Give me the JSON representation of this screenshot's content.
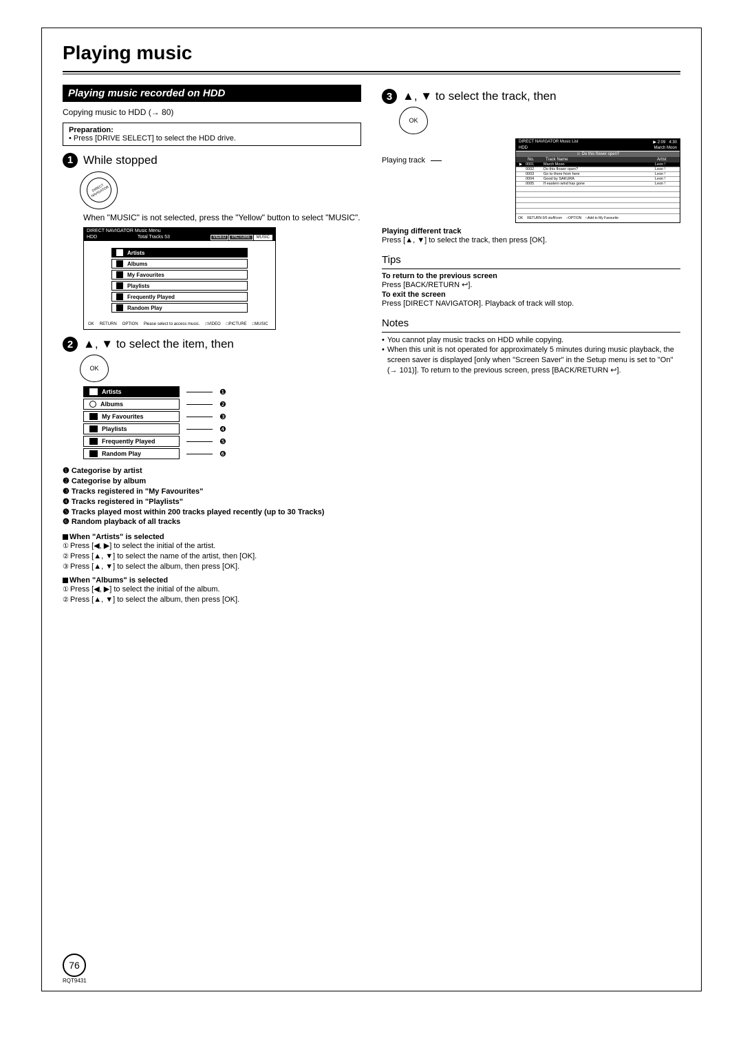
{
  "title": "Playing music",
  "section": "Playing music recorded on HDD",
  "copying": "Copying music to HDD (→ 80)",
  "prep": {
    "label": "Preparation:",
    "text": "• Press [DRIVE SELECT] to select the HDD drive."
  },
  "step1": {
    "text": "While stopped",
    "knob": "DIRECT NAVIGATOR",
    "instr": "When \"MUSIC\" is not selected, press the \"Yellow\" button to select \"MUSIC\"."
  },
  "musicMenu": {
    "hd1": "DIRECT NAVIGATOR   Music Menu",
    "hdd": "HDD",
    "total": "Total Tracks   53",
    "tabs": [
      "VIDEO",
      "PICTURE",
      "MUSIC"
    ],
    "items": [
      "Artists",
      "Albums",
      "My Favourites",
      "Playlists",
      "Frequently Played",
      "Random Play"
    ],
    "footerHint": "Please select to access music.",
    "footer": [
      "OK",
      "RETURN",
      "OPTION",
      "VIDEO",
      "PICTURE",
      "MUSIC"
    ]
  },
  "step2": {
    "text": "▲, ▼ to select the item, then",
    "ok": "OK"
  },
  "menuList": [
    {
      "label": "Artists",
      "num": "❶"
    },
    {
      "label": "Albums",
      "num": "❷"
    },
    {
      "label": "My Favourites",
      "num": "❸"
    },
    {
      "label": "Playlists",
      "num": "❹"
    },
    {
      "label": "Frequently Played",
      "num": "❺"
    },
    {
      "label": "Random Play",
      "num": "❻"
    }
  ],
  "defs": {
    "1": "Categorise by artist",
    "2": "Categorise by album",
    "3": "Tracks registered in \"My Favourites\"",
    "4": "Tracks registered in \"Playlists\"",
    "5": "Tracks played most within 200 tracks played recently (up to 30 Tracks)",
    "6": "Random playback of all tracks"
  },
  "artists": {
    "head": "When \"Artists\" is selected",
    "l1": "Press [◀, ▶] to select the initial of the artist.",
    "l2": "Press [▲, ▼] to select the name of the artist, then [OK].",
    "l3": "Press [▲, ▼] to select the album, then press [OK]."
  },
  "albums": {
    "head": "When \"Albums\" is selected",
    "l1": "Press [◀, ▶] to select the initial of the album.",
    "l2": "Press [▲, ▼] to select the album, then press [OK]."
  },
  "step3": {
    "text": "▲, ▼ to select the track, then",
    "ok": "OK",
    "playingLabel": "Playing track"
  },
  "tracklist": {
    "hd1": "DIRECT NAVIGATOR   Music List",
    "hdd": "HDD",
    "time": "2:09",
    "total": "4:30",
    "album": "March Moon",
    "now": "Do this flower open?",
    "cols": [
      "No.",
      "Track Name",
      "Artist"
    ],
    "rows": [
      {
        "no": "0001",
        "name": "March Moon",
        "artist": "Leon !"
      },
      {
        "no": "0002",
        "name": "Do this flower open?",
        "artist": "Leon !"
      },
      {
        "no": "0003",
        "name": "Go to there from here",
        "artist": "Leon !"
      },
      {
        "no": "0004",
        "name": "Good by SAKURA",
        "artist": "Leon !"
      },
      {
        "no": "0005",
        "name": "If eastern wind has gone",
        "artist": "Leon !"
      }
    ],
    "footer": [
      "OK",
      "RETURN 0/0 stuff/com",
      "OPTION",
      "Add to My Favourite"
    ]
  },
  "playingDiff": {
    "head": "Playing different track",
    "text": "Press [▲, ▼] to select the track, then press [OK]."
  },
  "tips": {
    "head": "Tips",
    "r1h": "To return to the previous screen",
    "r1t": "Press [BACK/RETURN ↩].",
    "r2h": "To exit the screen",
    "r2t": "Press [DIRECT NAVIGATOR]. Playback of track will stop."
  },
  "notes": {
    "head": "Notes",
    "b1": "You cannot play music tracks on HDD while copying.",
    "b2": "When this unit is not operated for approximately 5 minutes during music playback, the screen saver is displayed [only when \"Screen Saver\" in the Setup menu is set to \"On\" (→ 101)]. To return to the previous screen, press [BACK/RETURN ↩]."
  },
  "pageNum": "76",
  "docId": "RQT9431"
}
